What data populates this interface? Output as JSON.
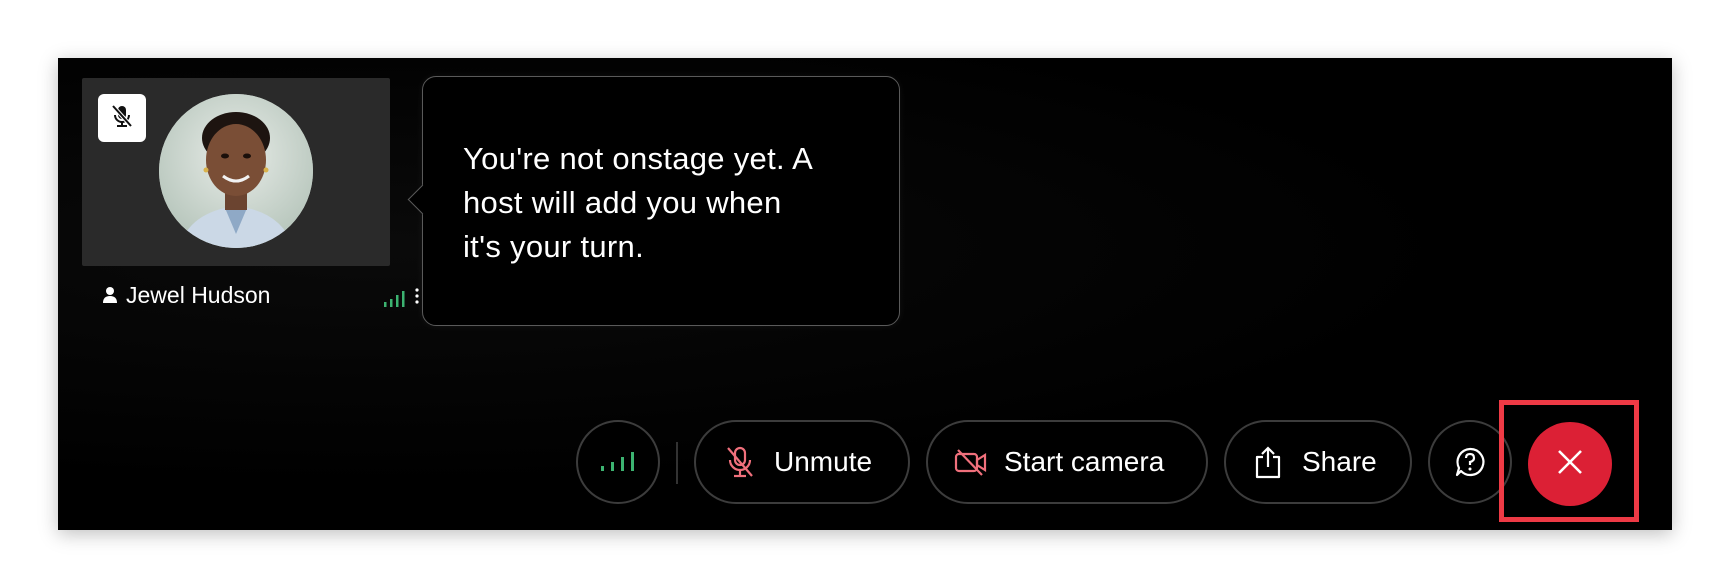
{
  "participant": {
    "name": "Jewel Hudson",
    "muted": true
  },
  "tooltip": {
    "line1": "You're not onstage yet. A",
    "line2": "host will add you when",
    "line3": "it's your turn."
  },
  "controls": {
    "unmute_label": "Unmute",
    "start_camera_label": "Start camera",
    "share_label": "Share"
  },
  "icons": {
    "mute_badge": "microphone-muted-icon",
    "person": "person-icon",
    "signal": "signal-strength-icon",
    "more": "more-vertical-icon",
    "network": "network-signal-icon",
    "unmute": "microphone-off-icon",
    "camera": "camera-off-icon",
    "share": "share-upload-icon",
    "help": "help-question-icon",
    "end": "close-icon"
  },
  "colors": {
    "background": "#000000",
    "end_button": "#dc2035",
    "highlight": "#ee3a45",
    "signal_green": "#3cb371",
    "muted_icon": "#f0707c"
  }
}
